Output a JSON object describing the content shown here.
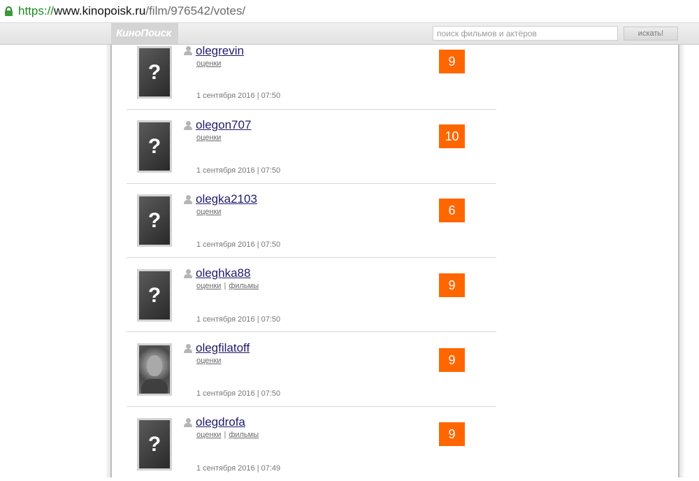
{
  "browser": {
    "url_scheme": "https://",
    "url_host": "www.kinopoisk.ru",
    "url_path": "/film/976542/votes/"
  },
  "header": {
    "logo": "КиноПоиск",
    "search_placeholder": "поиск фильмов и актёров",
    "search_button": "искать!"
  },
  "votes": [
    {
      "username": "olegrevin",
      "link1": "оценки",
      "link2": "",
      "date": "1 сентября 2016 | 07:50",
      "rating": "9",
      "avatar": "placeholder",
      "avatar_glyph": "?"
    },
    {
      "username": "olegon707",
      "link1": "оценки",
      "link2": "",
      "date": "1 сентября 2016 | 07:50",
      "rating": "10",
      "avatar": "placeholder",
      "avatar_glyph": "?"
    },
    {
      "username": "olegka2103",
      "link1": "оценки",
      "link2": "",
      "date": "1 сентября 2016 | 07:50",
      "rating": "6",
      "avatar": "placeholder",
      "avatar_glyph": "?"
    },
    {
      "username": "oleghka88",
      "link1": "оценки",
      "link2": "фильмы",
      "date": "1 сентября 2016 | 07:50",
      "rating": "9",
      "avatar": "placeholder",
      "avatar_glyph": "?"
    },
    {
      "username": "olegfilatoff",
      "link1": "оценки",
      "link2": "",
      "date": "1 сентября 2016 | 07:50",
      "rating": "9",
      "avatar": "photo",
      "avatar_glyph": ""
    },
    {
      "username": "olegdrofa",
      "link1": "оценки",
      "link2": "фильмы",
      "date": "1 сентября 2016 | 07:49",
      "rating": "9",
      "avatar": "placeholder",
      "avatar_glyph": "?"
    }
  ],
  "colors": {
    "rating_bg": "#ff6600",
    "username_link": "#1f1a6b",
    "secure_green": "#1e8a1e"
  },
  "icons": [
    "lock-icon",
    "user-icon"
  ]
}
